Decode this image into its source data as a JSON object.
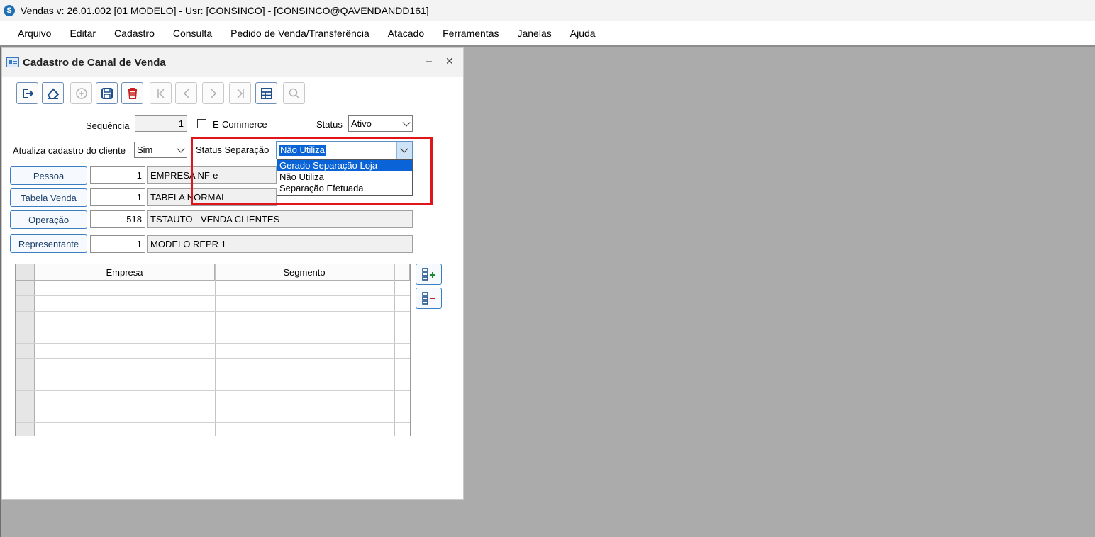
{
  "titlebar": {
    "icon_letter": "S",
    "title": "Vendas  v: 26.01.002   [01 MODELO] - Usr: [CONSINCO] - [CONSINCO@QAVENDANDD161]"
  },
  "menu": [
    {
      "label": "Arquivo"
    },
    {
      "label": "Editar"
    },
    {
      "label": "Cadastro"
    },
    {
      "label": "Consulta"
    },
    {
      "label": "Pedido de Venda/Transferência"
    },
    {
      "label": "Atacado"
    },
    {
      "label": "Ferramentas"
    },
    {
      "label": "Janelas"
    },
    {
      "label": "Ajuda"
    }
  ],
  "window": {
    "title": "Cadastro de Canal de Venda",
    "minimize": "–",
    "close": "✕"
  },
  "toolbar": [
    {
      "name": "exit-icon",
      "enabled": true
    },
    {
      "name": "eraser-icon",
      "enabled": true
    },
    {
      "name": "add-icon",
      "enabled": false
    },
    {
      "name": "save-icon",
      "enabled": true
    },
    {
      "name": "delete-icon",
      "enabled": true
    },
    {
      "name": "first-record-icon",
      "enabled": false
    },
    {
      "name": "previous-record-icon",
      "enabled": false
    },
    {
      "name": "next-record-icon",
      "enabled": false
    },
    {
      "name": "last-record-icon",
      "enabled": false
    },
    {
      "name": "grid-icon",
      "enabled": true
    },
    {
      "name": "search-icon",
      "enabled": false
    }
  ],
  "form": {
    "sequencia_label": "Sequência",
    "sequencia_value": "1",
    "ecommerce_label": "E-Commerce",
    "ecommerce_checked": false,
    "status_label": "Status",
    "status_value": "Ativo",
    "atualiza_label": "Atualiza cadastro do cliente",
    "atualiza_value": "Sim",
    "status_sep_label": "Status Separação",
    "status_sep_value": "Não Utiliza",
    "status_sep_options": [
      "Gerado Separação Loja",
      "Não Utiliza",
      "Separação Efetuada"
    ],
    "status_sep_highlighted": "Gerado Separação Loja",
    "pessoa_button": "Pessoa",
    "pessoa_code": "1",
    "pessoa_desc": "EMPRESA NF-e",
    "tabela_button": "Tabela Venda",
    "tabela_code": "1",
    "tabela_desc": "TABELA NORMAL",
    "operacao_button": "Operação",
    "operacao_code": "518",
    "operacao_desc": "TSTAUTO - VENDA CLIENTES",
    "representante_button": "Representante",
    "representante_code": "1",
    "representante_desc": "MODELO REPR 1"
  },
  "grid": {
    "columns": [
      "Empresa",
      "Segmento"
    ],
    "rows": 9
  },
  "side_buttons": [
    {
      "name": "add-row-icon"
    },
    {
      "name": "remove-row-icon"
    }
  ],
  "colors": {
    "highlight": "#e0141b",
    "selection": "#0a64d8",
    "accent": "#3c7fc0"
  }
}
